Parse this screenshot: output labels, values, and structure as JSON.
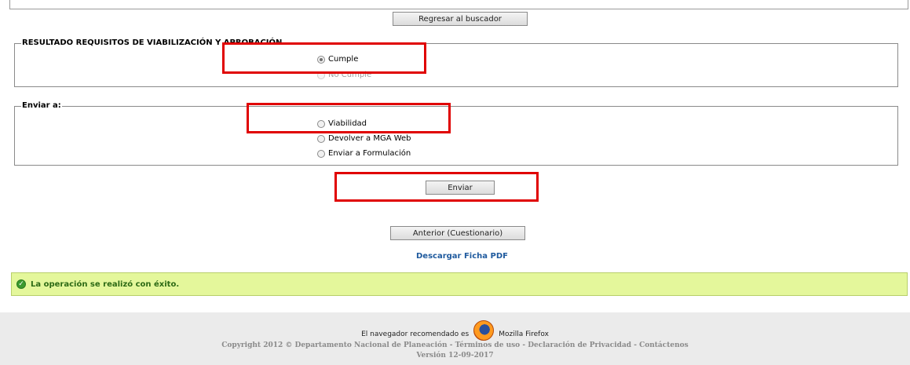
{
  "buttons": {
    "back_to_search": "Regresar al buscador",
    "send": "Enviar",
    "previous": "Anterior (Cuestionario)"
  },
  "result_section": {
    "legend": "RESULTADO REQUISITOS DE VIABILIZACIÓN Y APROBACIÓN",
    "options": [
      "Cumple",
      "No Cumple"
    ],
    "selected": "Cumple"
  },
  "send_to_section": {
    "legend": "Enviar a:",
    "options": [
      "Viabilidad",
      "Devolver a MGA Web",
      "Enviar a Formulación"
    ]
  },
  "download_link": "Descargar Ficha PDF",
  "success_message": "La operación se realizó con éxito.",
  "footer": {
    "browser_text": "El navegador recomendado es",
    "browser_name": "Mozilla Firefox",
    "copyright": "Copyright 2012 © Departamento Nacional de Planeación - Términos de uso - Declaración de Privacidad - Contáctenos",
    "version": "Versión 12-09-2017"
  },
  "colors": {
    "highlight": "#e00000",
    "success_bg": "#e4f79b",
    "link": "#1f5a9e"
  }
}
